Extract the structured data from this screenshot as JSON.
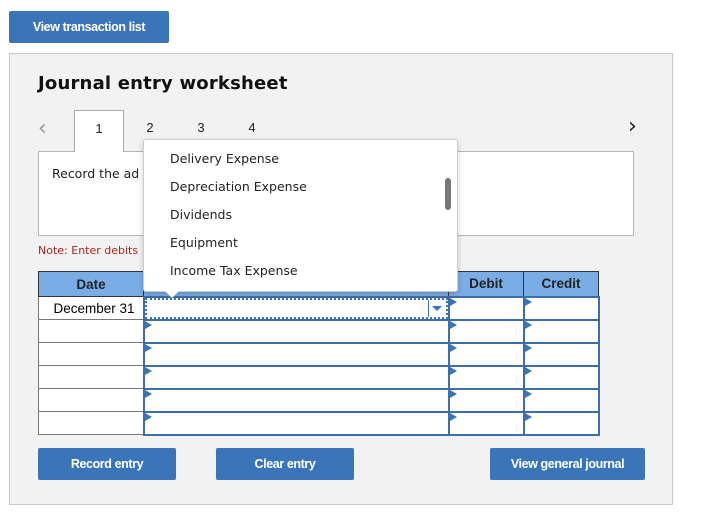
{
  "top_button": "View transaction list",
  "worksheet": {
    "title": "Journal entry worksheet",
    "prev_icon": "chevron-left-icon",
    "next_icon": "chevron-right-icon",
    "tabs": [
      {
        "label": "1",
        "active": true
      },
      {
        "label": "2",
        "active": false
      },
      {
        "label": "3",
        "active": false
      },
      {
        "label": "4",
        "active": false
      }
    ],
    "instruction": "Record the ad",
    "note": "Note: Enter debits"
  },
  "table": {
    "headers": {
      "date": "Date",
      "account": "",
      "debit": "Debit",
      "credit": "Credit"
    },
    "rows": [
      {
        "date": "December 31",
        "account": "",
        "debit": "",
        "credit": ""
      },
      {
        "date": "",
        "account": "",
        "debit": "",
        "credit": ""
      },
      {
        "date": "",
        "account": "",
        "debit": "",
        "credit": ""
      },
      {
        "date": "",
        "account": "",
        "debit": "",
        "credit": ""
      },
      {
        "date": "",
        "account": "",
        "debit": "",
        "credit": ""
      },
      {
        "date": "",
        "account": "",
        "debit": "",
        "credit": ""
      }
    ]
  },
  "dropdown_menu": {
    "options": [
      "Delivery Expense",
      "Depreciation Expense",
      "Dividends",
      "Equipment",
      "Income Tax Expense"
    ]
  },
  "buttons": {
    "record": "Record entry",
    "clear": "Clear entry",
    "view_journal": "View general journal"
  }
}
